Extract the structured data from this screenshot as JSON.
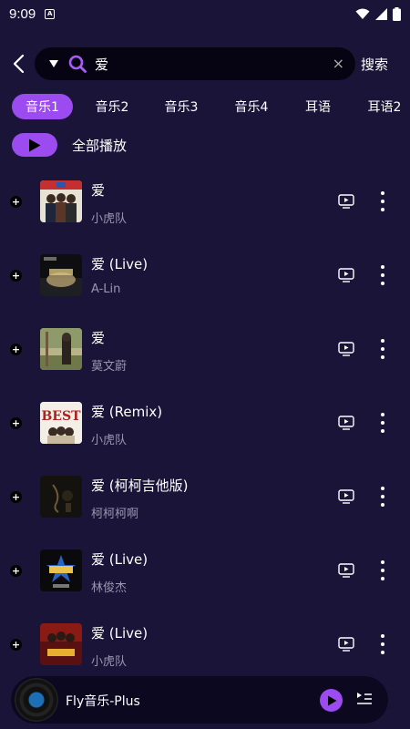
{
  "status": {
    "time": "9:09",
    "notification_glyph": "A"
  },
  "search": {
    "query": "爱",
    "clear_glyph": "×",
    "button_label": "搜索"
  },
  "tabs": [
    {
      "label": "音乐1",
      "active": true
    },
    {
      "label": "音乐2",
      "active": false
    },
    {
      "label": "音乐3",
      "active": false
    },
    {
      "label": "音乐4",
      "active": false
    },
    {
      "label": "耳语",
      "active": false
    },
    {
      "label": "耳语2",
      "active": false
    }
  ],
  "play_all": {
    "label": "全部播放"
  },
  "songs": [
    {
      "title": "爱",
      "artist": "小虎队"
    },
    {
      "title": "爱 (Live)",
      "artist": "A-Lin"
    },
    {
      "title": "爱",
      "artist": "莫文蔚"
    },
    {
      "title": "爱 (Remix)",
      "artist": "小虎队"
    },
    {
      "title": "爱 (柯柯吉他版)",
      "artist": "柯柯柯啊"
    },
    {
      "title": "爱 (Live)",
      "artist": "林俊杰"
    },
    {
      "title": "爱 (Live)",
      "artist": "小虎队"
    }
  ],
  "cover_texts": {
    "best": "BEST"
  },
  "player": {
    "title": "Fly音乐-Plus"
  },
  "colors": {
    "background": "#1a1538",
    "accent": "#9b4bf0",
    "search_bg": "#060413",
    "secondary_text": "#9a95b0"
  }
}
